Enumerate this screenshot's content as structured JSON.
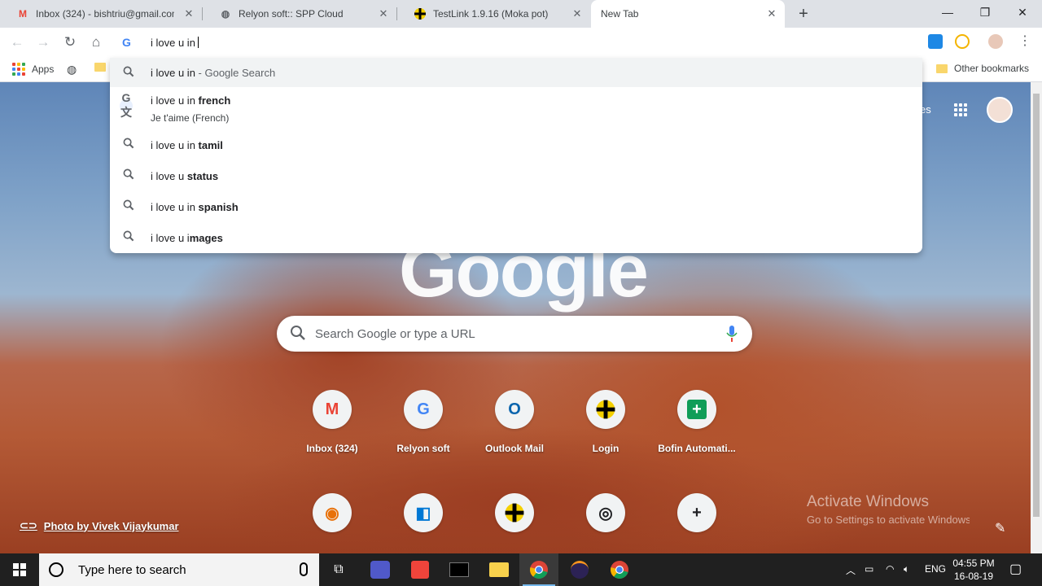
{
  "tabs": [
    {
      "title": "Inbox (324) - bishtriu@gmail.com",
      "icon": "gmail-icon",
      "icon_glyph": "M",
      "icon_color": "#ea4335"
    },
    {
      "title": "Relyon soft:: SPP Cloud",
      "icon": "globe-icon",
      "icon_glyph": "◍",
      "icon_color": "#5f6368"
    },
    {
      "title": "TestLink 1.9.16 (Moka pot)",
      "icon": "testlink-icon",
      "icon_glyph": "◆",
      "icon_color": "#000000"
    },
    {
      "title": "New Tab",
      "icon": "",
      "icon_glyph": "",
      "icon_color": "#5f6368"
    }
  ],
  "omnibox": {
    "text": "i love u in"
  },
  "bookmarks": {
    "apps_label": "Apps",
    "other_label": "Other bookmarks"
  },
  "suggestions": [
    {
      "typed": "i love u in",
      "bold": "",
      "suffix": " - Google Search",
      "sub": "",
      "icon": "search-icon"
    },
    {
      "typed": "i love u in ",
      "bold": "french",
      "suffix": "",
      "sub": "Je t'aime (French)",
      "icon": "google-translate-icon"
    },
    {
      "typed": "i love u in ",
      "bold": "tamil",
      "suffix": "",
      "sub": "",
      "icon": "search-icon"
    },
    {
      "typed": "i love u ",
      "bold": "status",
      "suffix": "",
      "sub": "",
      "icon": "search-icon"
    },
    {
      "typed": "i love u in ",
      "bold": "spanish",
      "suffix": "",
      "sub": "",
      "icon": "search-icon"
    },
    {
      "typed": "i love u i",
      "bold": "mages",
      "suffix": "",
      "sub": "",
      "icon": "search-icon"
    }
  ],
  "ntp": {
    "logo": "Google",
    "search_placeholder": "Search Google or type a URL",
    "shortcuts": [
      {
        "label": "Inbox (324)",
        "glyph": "M",
        "color": "#ea4335"
      },
      {
        "label": "Relyon soft",
        "glyph": "G",
        "color": "#4285f4"
      },
      {
        "label": "Outlook Mail",
        "glyph": "O",
        "color": "#0a64ad"
      },
      {
        "label": "Login",
        "glyph": "◆",
        "color": "#000000"
      },
      {
        "label": "Bofin Automati...",
        "glyph": "+",
        "color": "#0f9d58"
      },
      {
        "label": "",
        "glyph": "◉",
        "color": "#e8710a"
      },
      {
        "label": "",
        "glyph": "◧",
        "color": "#0078d4"
      },
      {
        "label": "",
        "glyph": "◆",
        "color": "#000000"
      },
      {
        "label": "",
        "glyph": "◎",
        "color": "#202124"
      },
      {
        "label": "",
        "glyph": "+",
        "color": "#202124"
      }
    ],
    "photo_credit": "Photo by Vivek Vijaykumar",
    "right_text": "es"
  },
  "activation": {
    "line1": "Activate Windows",
    "line2": "Go to Settings to activate Windows."
  },
  "taskbar": {
    "search_placeholder": "Type here to search",
    "language": "ENG",
    "time": "04:55 PM",
    "date": "16-08-19"
  },
  "colors": {
    "accent": "#1a73e8",
    "taskbar": "#202020",
    "tabstrip": "#dee1e6"
  }
}
